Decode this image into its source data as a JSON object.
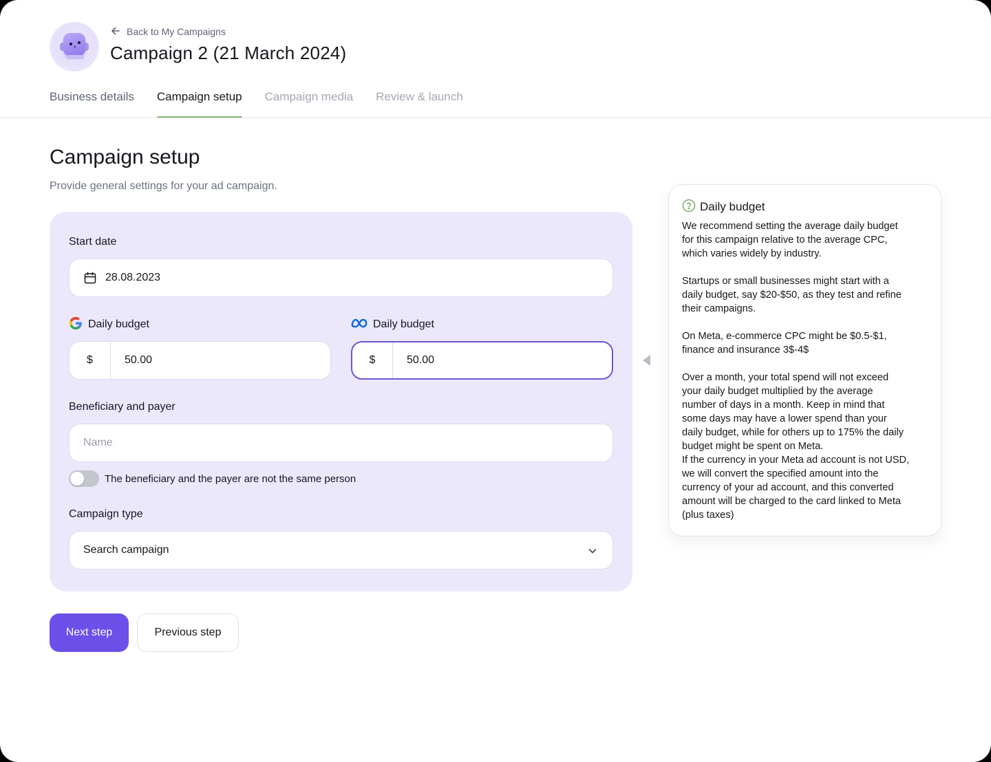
{
  "header": {
    "back_link": "Back to My Campaigns",
    "title": "Campaign 2 (21 March 2024)"
  },
  "tabs": [
    {
      "label": "Business details",
      "state": "completed"
    },
    {
      "label": "Campaign setup",
      "state": "active"
    },
    {
      "label": "Campaign media",
      "state": "disabled"
    },
    {
      "label": "Review & launch",
      "state": "disabled"
    }
  ],
  "section": {
    "title": "Campaign setup",
    "subtitle": "Provide general settings for your ad campaign."
  },
  "form": {
    "start_date": {
      "label": "Start date",
      "value": "28.08.2023"
    },
    "google_budget": {
      "label": "Daily budget",
      "currency": "$",
      "value": "50.00"
    },
    "meta_budget": {
      "label": "Daily budget",
      "currency": "$",
      "value": "50.00"
    },
    "beneficiary": {
      "label": "Beneficiary and payer",
      "placeholder": "Name",
      "value": ""
    },
    "toggle": {
      "label": "The beneficiary and the payer are not the same person",
      "on": false
    },
    "campaign_type": {
      "label": "Campaign type",
      "value": "Search campaign"
    }
  },
  "buttons": {
    "next": "Next step",
    "previous": "Previous step"
  },
  "info_panel": {
    "title": "Daily budget",
    "paragraphs": [
      "We recommend setting the average daily budget\nfor this campaign relative to the average CPC,\nwhich varies widely by industry.",
      "Startups or small businesses might start with a\ndaily budget, say $20-$50, as they test and refine\ntheir campaigns.",
      "On Meta, e-commerce CPC might be $0.5-$1,\nfinance and insurance 3$-4$",
      "Over a month, your total spend will not exceed\nyour daily budget multiplied by the average\nnumber of days in a month. Keep in mind that\nsome days may have a lower spend than your\ndaily budget, while for others up to 175% the daily\nbudget might be spent on Meta.",
      "If the currency in your Meta ad account is not USD,\nwe will convert the specified amount into the\ncurrency of your ad account, and this converted\namount will be charged to the card linked to Meta\n(plus taxes)"
    ]
  },
  "colors": {
    "accent": "#6d50ea",
    "form_background": "#ece8fc",
    "active_tab_indicator": "#8cb67a",
    "focus_border": "#6f54d9"
  }
}
